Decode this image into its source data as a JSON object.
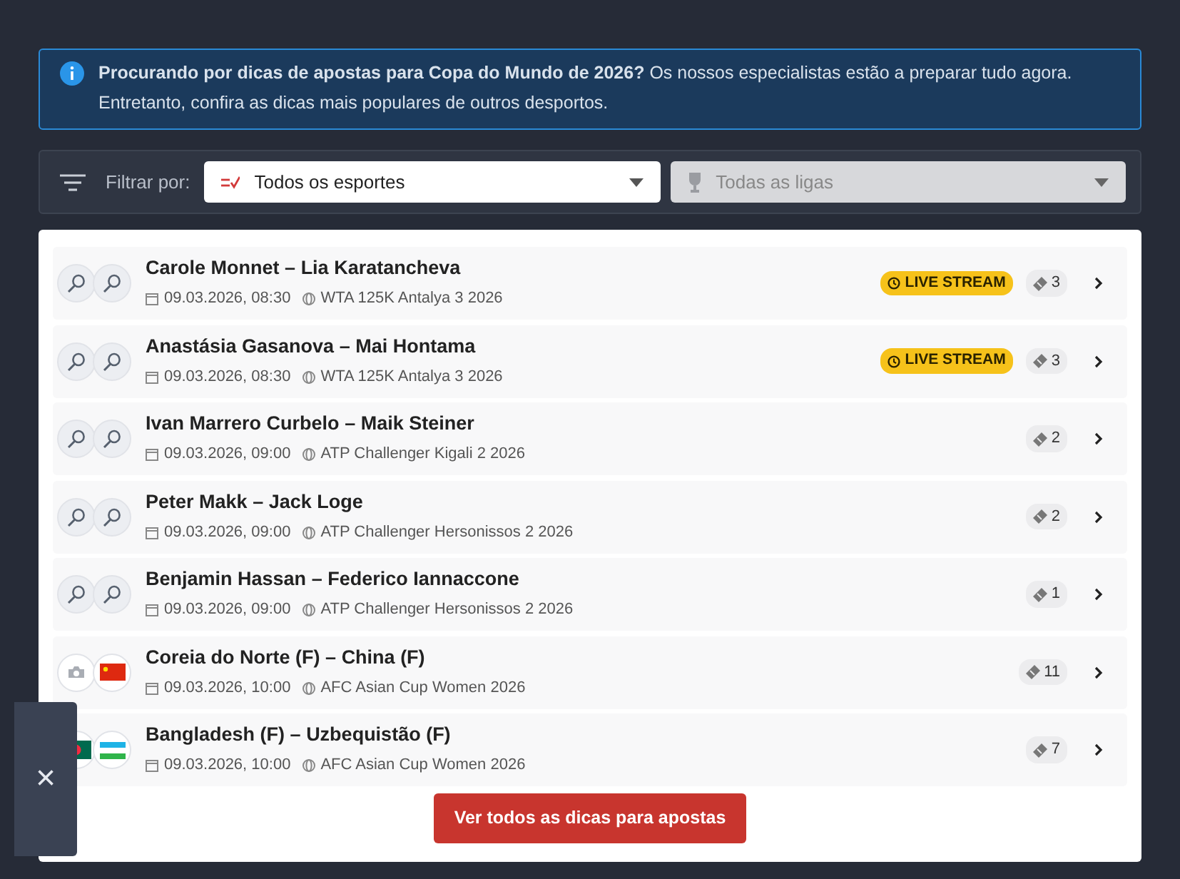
{
  "alert": {
    "text": "**Procurando por dicas de apostas para Copa do Mundo de 2026?** Os nossos especialistas estão a preparar tudo agora. Entretanto, confira as dicas mais populares de outros desportos."
  },
  "filter": {
    "label": "Filtrar por:",
    "sport": {
      "value": "Todos os esportes",
      "disabled": false
    },
    "league": {
      "value": "Todas as ligas",
      "disabled": true
    }
  },
  "matches": [
    {
      "home": {
        "name": "Carole Monnet",
        "kind": "racket"
      },
      "separator": "–",
      "away": {
        "name": "Lia Karatancheva",
        "kind": "racket"
      },
      "date": "09.03.2026, 08:30",
      "league": "WTA 125K Antalya 3 2026",
      "live": true,
      "live_label": "LIVE STREAM",
      "tips": "3"
    },
    {
      "home": {
        "name": "Anastásia Gasanova",
        "kind": "racket"
      },
      "separator": "–",
      "away": {
        "name": "Mai Hontama",
        "kind": "racket"
      },
      "date": "09.03.2026, 08:30",
      "league": "WTA 125K Antalya 3 2026",
      "live": true,
      "live_label": "LIVE STREAM",
      "tips": "3"
    },
    {
      "home": {
        "name": "Ivan Marrero Curbelo",
        "kind": "racket"
      },
      "separator": "–",
      "away": {
        "name": "Maik Steiner",
        "kind": "racket"
      },
      "date": "09.03.2026, 09:00",
      "league": "ATP Challenger Kigali 2 2026",
      "live": false,
      "tips": "2"
    },
    {
      "home": {
        "name": "Peter Makk",
        "kind": "racket"
      },
      "separator": "–",
      "away": {
        "name": "Jack Loge",
        "kind": "racket"
      },
      "date": "09.03.2026, 09:00",
      "league": "ATP Challenger Hersonissos 2 2026",
      "live": false,
      "tips": "2"
    },
    {
      "home": {
        "name": "Benjamin Hassan",
        "kind": "racket"
      },
      "separator": "–",
      "away": {
        "name": "Federico Iannaccone",
        "kind": "racket"
      },
      "date": "09.03.2026, 09:00",
      "league": "ATP Challenger Hersonissos 2 2026",
      "live": false,
      "tips": "1"
    },
    {
      "home": {
        "name": "Coreia do Norte (F)",
        "kind": "camera"
      },
      "separator": "–",
      "away": {
        "name": "China (F)",
        "kind": "chinaflag"
      },
      "date": "09.03.2026, 10:00",
      "league": "AFC Asian Cup Women 2026",
      "live": false,
      "tips": "11"
    },
    {
      "home": {
        "name": "Bangladesh (F)",
        "kind": "bangladeshflag"
      },
      "separator": "–",
      "away": {
        "name": "Uzbequistão (F)",
        "kind": "uzbekflag"
      },
      "date": "09.03.2026, 10:00",
      "league": "AFC Asian Cup Women 2026",
      "live": false,
      "tips": "7"
    }
  ],
  "button": "Ver todos as dicas para apostas",
  "side_panel": {
    "close": "×"
  }
}
